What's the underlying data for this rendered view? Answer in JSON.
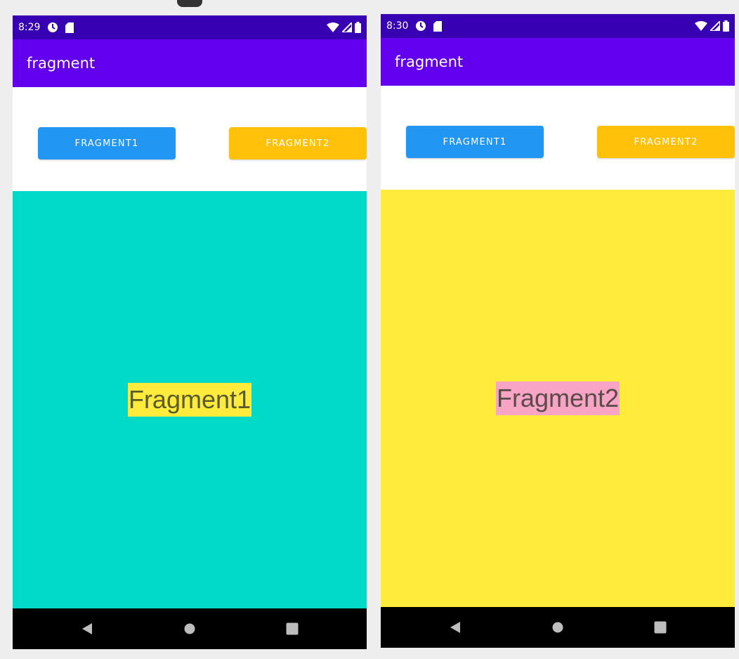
{
  "colors": {
    "status_bar": "#3700b3",
    "app_bar": "#6200ee",
    "button1": "#2196f3",
    "button2": "#ffc107",
    "nav_bar": "#000000",
    "nav_icons": "#bdbdbd"
  },
  "screens": [
    {
      "status_time": "8:29",
      "app_title": "fragment",
      "button1_label": "FRAGMENT1",
      "button2_label": "FRAGMENT2",
      "fragment_label": "Fragment1",
      "fragment_background": "#00d9c6",
      "label_background": "#ffeb3b",
      "label_color": "#5a5a2a"
    },
    {
      "status_time": "8:30",
      "app_title": "fragment",
      "button1_label": "FRAGMENT1",
      "button2_label": "FRAGMENT2",
      "fragment_label": "Fragment2",
      "fragment_background": "#ffeb3b",
      "label_background": "#f8a4c4",
      "label_color": "#5a4a4a"
    }
  ]
}
